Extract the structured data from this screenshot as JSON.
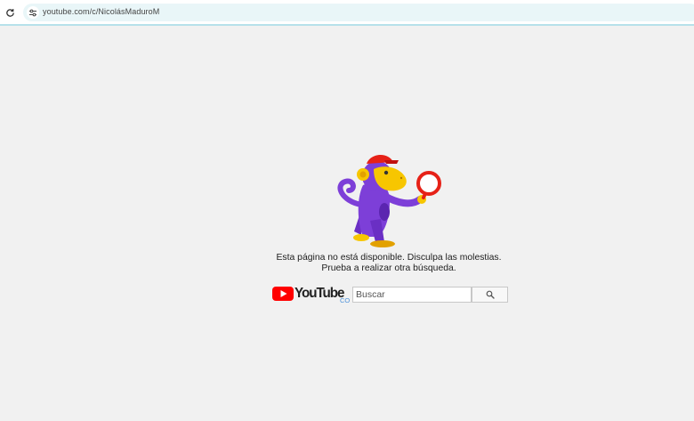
{
  "browser": {
    "url": "youtube.com/c/NicolásMaduroM"
  },
  "error": {
    "line1": "Esta página no está disponible. Disculpa las molestias.",
    "line2": "Prueba a realizar otra búsqueda."
  },
  "logo": {
    "wordmark": "YouTube",
    "country": "CO"
  },
  "search": {
    "placeholder": "Buscar",
    "value": ""
  },
  "icons": {
    "reload": "reload-icon",
    "site_settings": "site-settings-icon",
    "search": "search-icon",
    "play": "play-icon"
  },
  "colors": {
    "background": "#f1f1f1",
    "youtube_red": "#ff0000",
    "monkey_purple": "#7d3fd8",
    "monkey_yellow": "#f7c600",
    "magnifier_red": "#e62117"
  }
}
